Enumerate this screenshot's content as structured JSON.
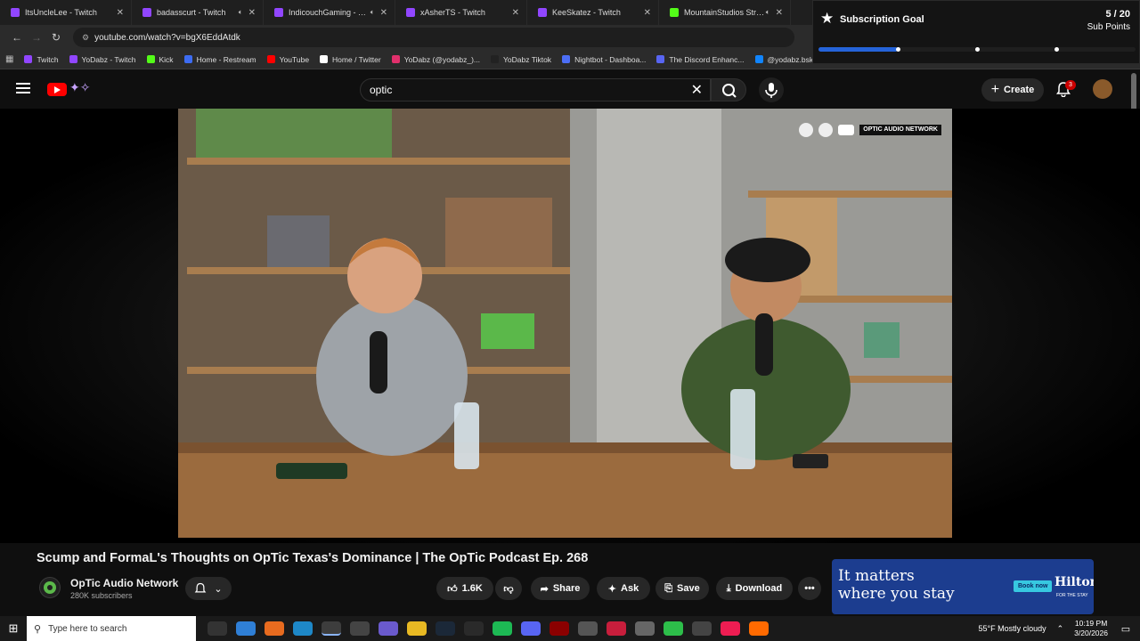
{
  "browser": {
    "tabs": [
      {
        "title": "ItsUncleLee - Twitch",
        "color": "#9146ff",
        "muted": false
      },
      {
        "title": "badasscurt - Twitch",
        "color": "#9146ff",
        "muted": true
      },
      {
        "title": "IndicouchGaming - Twitch",
        "color": "#9146ff",
        "muted": true
      },
      {
        "title": "xAsherTS - Twitch",
        "color": "#9146ff",
        "muted": false
      },
      {
        "title": "KeeSkatez - Twitch",
        "color": "#9146ff",
        "muted": false
      },
      {
        "title": "MountainStudios Stream",
        "color": "#53fc18",
        "muted": true
      }
    ],
    "url": "youtube.com/watch?v=bgX6EddAtdk",
    "bookmarks": [
      {
        "label": "Twitch",
        "color": "#9146ff"
      },
      {
        "label": "YoDabz - Twitch",
        "color": "#9146ff"
      },
      {
        "label": "Kick",
        "color": "#53fc18"
      },
      {
        "label": "Home - Restream",
        "color": "#3d6cf2"
      },
      {
        "label": "YouTube",
        "color": "#ff0000"
      },
      {
        "label": "Home / Twitter",
        "color": "#ffffff"
      },
      {
        "label": "YoDabz (@yodabz_)...",
        "color": "#e1306c"
      },
      {
        "label": "YoDabz Tiktok",
        "color": "#222222"
      },
      {
        "label": "Nightbot - Dashboa...",
        "color": "#4c6ef5"
      },
      {
        "label": "The Discord Enhanc...",
        "color": "#5865f2"
      },
      {
        "label": "@yodabz.bsky.socia...",
        "color": "#1185fe"
      }
    ]
  },
  "sub_goal": {
    "title": "Subscription Goal",
    "count": "5 / 20",
    "unit": "Sub Points",
    "progress": 0.25,
    "markers": [
      0.25,
      0.5,
      0.75
    ],
    "accent": "#2563d9"
  },
  "youtube": {
    "search_value": "optic",
    "create_label": "Create",
    "notification_count": "3",
    "video_overlay_logo": "OPTIC AUDIO NETWORK",
    "video_title": "Scump and FormaL's Thoughts on OpTic Texas's Dominance | The OpTic Podcast Ep. 268",
    "channel_name": "OpTic Audio Network",
    "channel_subs": "280K subscribers",
    "likes": "1.6K",
    "share_label": "Share",
    "ask_label": "Ask",
    "save_label": "Save",
    "download_label": "Download"
  },
  "ad": {
    "headline_1": "It matters",
    "headline_2": "where you stay",
    "cta": "Book now",
    "brand": "Hilton",
    "brand_sub": "FOR THE STAY"
  },
  "taskbar": {
    "search_placeholder": "Type here to search",
    "weather": "55°F  Mostly cloudy",
    "time": "10:19 PM",
    "date": "3/20/2026"
  }
}
